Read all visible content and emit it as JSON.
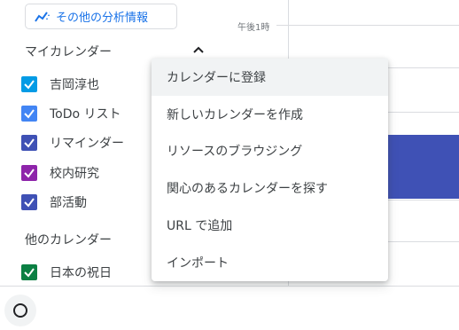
{
  "sidebar": {
    "insights_button": "その他の分析情報",
    "my_calendars_title": "マイカレンダー",
    "my_calendars": [
      {
        "label": "吉岡淳也",
        "color": "#039be5"
      },
      {
        "label": "ToDo リスト",
        "color": "#4285f4"
      },
      {
        "label": "リマインダー",
        "color": "#3f51b5"
      },
      {
        "label": "校内研究",
        "color": "#8e24aa"
      },
      {
        "label": "部活動",
        "color": "#3f51b5"
      }
    ],
    "other_calendars_title": "他のカレンダー",
    "other_calendars": [
      {
        "label": "日本の祝日",
        "color": "#0b8043"
      }
    ]
  },
  "main": {
    "time_label": "午後1時"
  },
  "menu": {
    "items": [
      "カレンダーに登録",
      "新しいカレンダーを作成",
      "リソースのブラウジング",
      "関心のあるカレンダーを探す",
      "URL で追加",
      "インポート"
    ]
  },
  "colors": {
    "accent": "#1a73e8",
    "event": "#3f51b5"
  }
}
